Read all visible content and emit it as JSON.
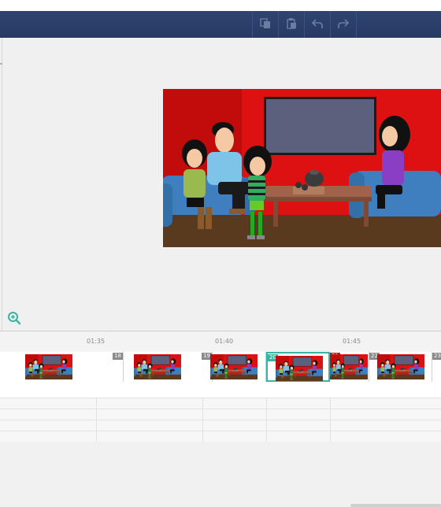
{
  "toolbar": {
    "buttons": [
      {
        "name": "copy-icon"
      },
      {
        "name": "paste-icon"
      },
      {
        "name": "undo-icon"
      },
      {
        "name": "redo-icon"
      }
    ]
  },
  "preview": {
    "zoom_icon": "zoom-in-icon"
  },
  "timeline": {
    "ticks": [
      "01:35",
      "01:40",
      "01:45"
    ],
    "clips": [
      {
        "number": "18",
        "style": "gray"
      },
      {
        "number": "19",
        "style": "gray"
      },
      {
        "number": "20",
        "style": "teal",
        "selected": true
      },
      {
        "number": "21",
        "style": "red"
      },
      {
        "number": "22",
        "style": "gray"
      },
      {
        "number": "23",
        "style": "gray"
      }
    ]
  },
  "colors": {
    "toolbar": "#2b3f6a",
    "accent": "#3bb3a4",
    "scene_wall": "#e01414",
    "sofa": "#3f7fbf"
  }
}
